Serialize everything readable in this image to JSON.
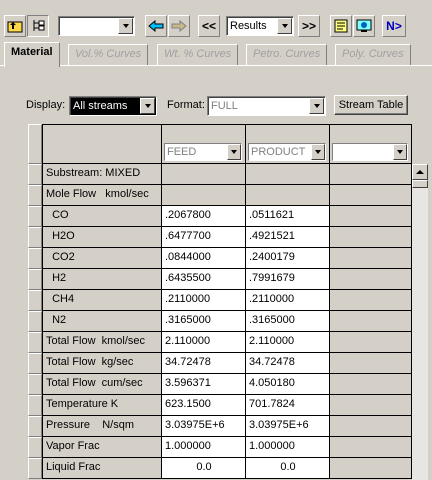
{
  "toolbar": {
    "stream_selector_value": "",
    "form_selector_value": "Results",
    "prev_label": "<<",
    "next_label": ">>",
    "next_step_label": "N>"
  },
  "tabs": [
    {
      "label": "Material",
      "active": true
    },
    {
      "label": "Vol.% Curves",
      "active": false
    },
    {
      "label": "Wt. % Curves",
      "active": false
    },
    {
      "label": "Petro. Curves",
      "active": false
    },
    {
      "label": "Poly. Curves",
      "active": false
    }
  ],
  "display": {
    "label": "Display:",
    "value": "All streams"
  },
  "format": {
    "label": "Format:",
    "value": "FULL"
  },
  "stream_table_button": "Stream Table",
  "table": {
    "columns": [
      "FEED",
      "PRODUCT",
      ""
    ],
    "rows": [
      {
        "label": "Substream: MIXED",
        "values": [
          "",
          ""
        ]
      },
      {
        "label": "Mole Flow   kmol/sec",
        "values": [
          "",
          ""
        ]
      },
      {
        "label": "  CO",
        "values": [
          ".2067800",
          ".0511621"
        ]
      },
      {
        "label": "  H2O",
        "values": [
          ".6477700",
          ".4921521"
        ]
      },
      {
        "label": "  CO2",
        "values": [
          ".0844000",
          ".2400179"
        ]
      },
      {
        "label": "  H2",
        "values": [
          ".6435500",
          ".7991679"
        ]
      },
      {
        "label": "  CH4",
        "values": [
          ".2110000",
          ".2110000"
        ]
      },
      {
        "label": "  N2",
        "values": [
          ".3165000",
          ".3165000"
        ]
      },
      {
        "label": "Total Flow  kmol/sec",
        "values": [
          "2.110000",
          "2.110000"
        ]
      },
      {
        "label": "Total Flow  kg/sec",
        "values": [
          "34.72478",
          "34.72478"
        ]
      },
      {
        "label": "Total Flow  cum/sec",
        "values": [
          "3.596371",
          "4.050180"
        ]
      },
      {
        "label": "Temperature K",
        "values": [
          "623.1500",
          "701.7824"
        ]
      },
      {
        "label": "Pressure    N/sqm",
        "values": [
          "3.03975E+6",
          "3.03975E+6"
        ]
      },
      {
        "label": "Vapor Frac",
        "values": [
          "1.000000",
          "1.000000"
        ]
      },
      {
        "label": "Liquid Frac",
        "values": [
          "0.0",
          "0.0"
        ]
      }
    ]
  }
}
